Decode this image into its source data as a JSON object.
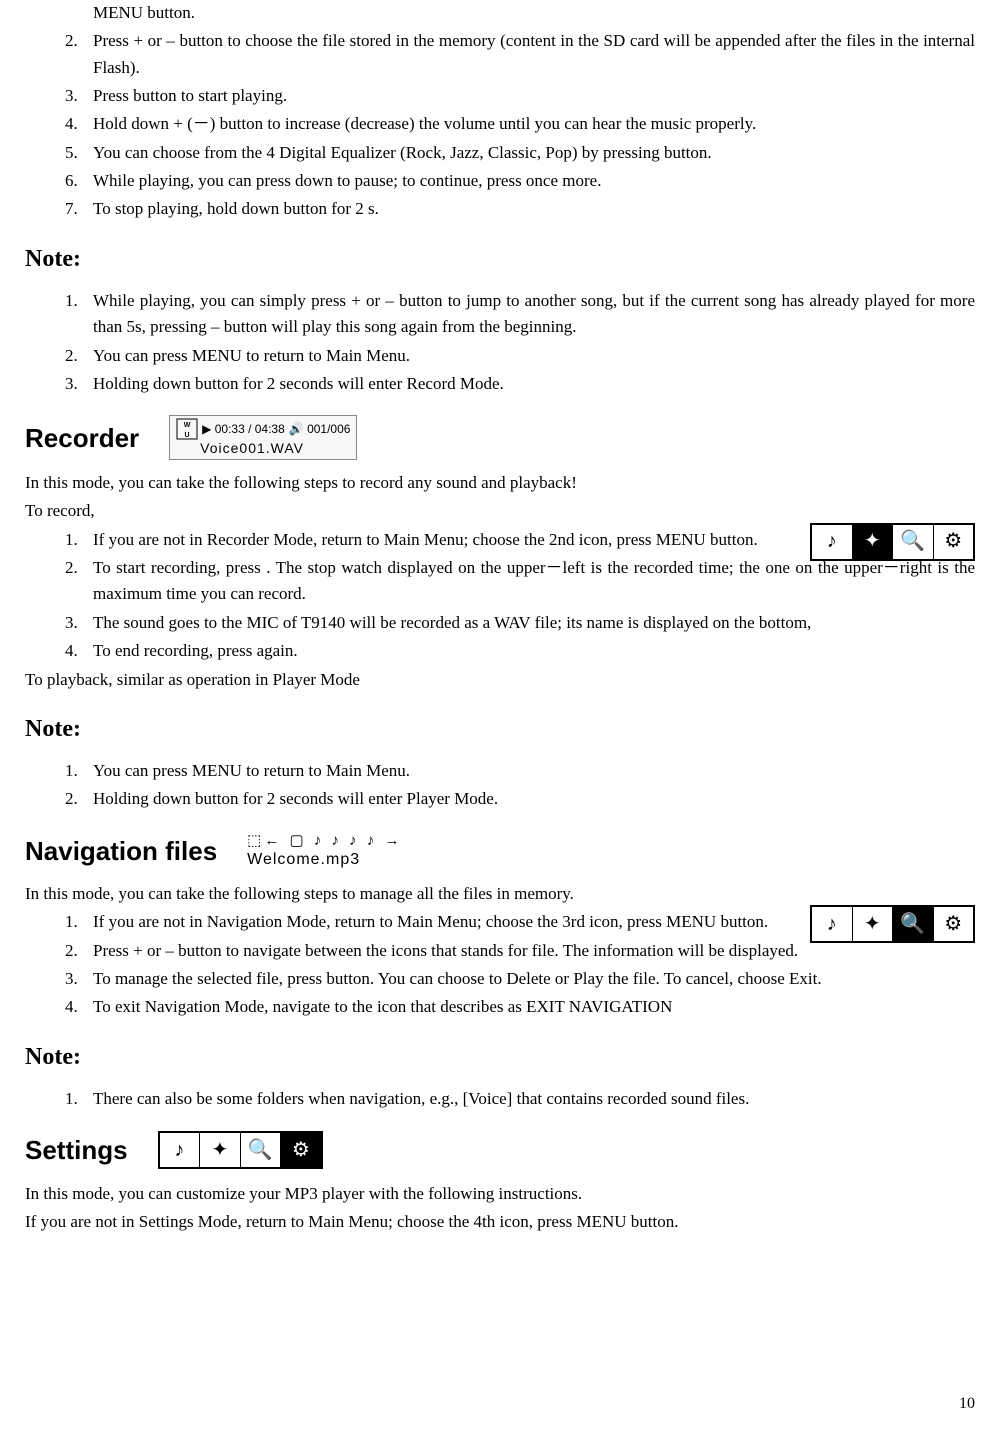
{
  "topList": {
    "continued": "MENU button.",
    "items": [
      {
        "num": "2.",
        "text": "Press + or – button to choose the file stored in the memory (content in the SD card will be appended after the files in the internal Flash)."
      },
      {
        "num": "3.",
        "text": "Press        button to start playing."
      },
      {
        "num": "4.",
        "text": "Hold down + (－) button to increase (decrease) the volume until you can hear the music properly."
      },
      {
        "num": "5.",
        "text": "You can choose from the 4 Digital Equalizer (Rock, Jazz, Classic, Pop) by pressing        button."
      },
      {
        "num": "6.",
        "text": "While playing, you can press down        to pause; to continue, press        once more."
      },
      {
        "num": "7.",
        "text": "To stop playing, hold down        button for 2 s."
      }
    ]
  },
  "note1": {
    "heading": "Note:",
    "items": [
      {
        "num": "1.",
        "text": "While playing, you can simply press + or – button to jump to another song, but if the current song has already played for more than 5s, pressing – button will play this song again from the beginning."
      },
      {
        "num": "2.",
        "text": "You can press MENU to return to Main Menu."
      },
      {
        "num": "3.",
        "text": "Holding down        button for 2 seconds will enter Record Mode."
      }
    ]
  },
  "recorder": {
    "heading": "Recorder",
    "lcd": {
      "time": "00:33 / 04:38",
      "track": "001/006",
      "file": "Voice001.WAV"
    },
    "intro1": "In this mode, you can take the following steps to record any sound and playback!",
    "intro2": "To record,",
    "items": [
      {
        "num": "1.",
        "text": "If you are not in Recorder Mode, return to Main Menu; choose the 2nd icon, press MENU button."
      },
      {
        "num": "2.",
        "text": "To start recording, press      . The stop watch displayed on the upper－left is the recorded time; the one on the upper－right is the maximum time you can record."
      },
      {
        "num": "3.",
        "text": "The sound goes to the MIC of T9140 will be recorded as a WAV file; its name is displayed on the bottom,"
      },
      {
        "num": "4.",
        "text": "To end recording, press        again."
      }
    ],
    "outro": "To playback, similar as operation in Player Mode"
  },
  "note2": {
    "heading": "Note:",
    "items": [
      {
        "num": "1.",
        "text": "You can press MENU to return to Main Menu."
      },
      {
        "num": "2.",
        "text": "Holding down        button for 2 seconds will enter Player Mode."
      }
    ]
  },
  "navigation": {
    "heading": "Navigation files",
    "lcd": {
      "icons": "⬚← ▢ ♪ ♪ ♪ ♪ →",
      "file": "Welcome.mp3"
    },
    "intro": "In this mode, you can take the following steps to manage all the files in memory.",
    "items": [
      {
        "num": "1.",
        "text": "If you are not in Navigation Mode, return to Main Menu; choose the 3rd icon, press MENU button."
      },
      {
        "num": "2.",
        "text": "Press + or – button to navigate between the icons that stands for file. The information will be displayed."
      },
      {
        "num": "3.",
        "text": "To manage the selected file, press        button. You can choose to Delete or Play the file. To cancel, choose Exit."
      },
      {
        "num": "4.",
        "text": "To exit Navigation Mode, navigate to the icon that describes as EXIT NAVIGATION"
      }
    ]
  },
  "note3": {
    "heading": "Note:",
    "items": [
      {
        "num": "1.",
        "text": "There can also be some folders when navigation, e.g., [Voice] that contains recorded sound files."
      }
    ]
  },
  "settings": {
    "heading": "Settings",
    "intro1": "In this mode, you can customize your MP3 player with the following instructions.",
    "intro2": "If you are not in Settings Mode, return to Main Menu; choose the 4th icon, press MENU button."
  },
  "icons": {
    "music": "♪",
    "mic": "✦",
    "search": "🔍",
    "tool": "⚙"
  },
  "pageNum": "10"
}
